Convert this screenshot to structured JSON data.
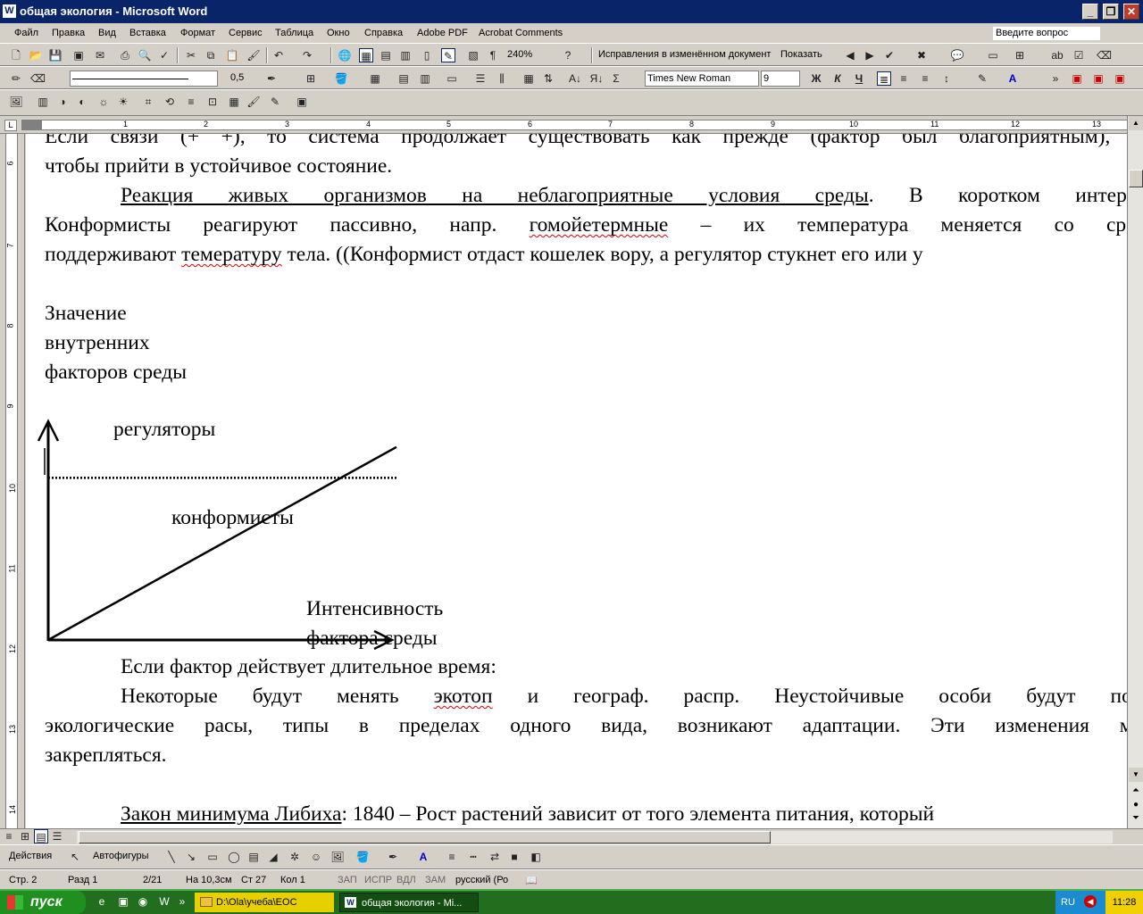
{
  "window": {
    "title": "общая экология - Microsoft Word",
    "app_icon": "W",
    "ask_placeholder": "Введите вопрос"
  },
  "menu": [
    "Файл",
    "Правка",
    "Вид",
    "Вставка",
    "Формат",
    "Сервис",
    "Таблица",
    "Окно",
    "Справка",
    "Adobe PDF",
    "Acrobat Comments"
  ],
  "toolbar": {
    "zoom": "240%",
    "track_changes_view": "Исправления в изменённом документ",
    "show_label": "Показать",
    "line_weight": "0,5",
    "font_name": "Times New Roman",
    "font_size": "9"
  },
  "ruler": {
    "h_numbers": [
      "1",
      "2",
      "3",
      "4",
      "5",
      "6",
      "7",
      "8",
      "9",
      "10",
      "11",
      "12",
      "13"
    ],
    "v_numbers": [
      "6",
      "7",
      "8",
      "9",
      "10",
      "11",
      "12",
      "13",
      "14"
    ]
  },
  "document": {
    "line0": "Если связи (+ +), то система продолжает существовать как прежде (фактор был благоприятным), со",
    "line1": "чтобы прийти в устойчивое состояние.",
    "p2_title": "Реакция живых организмов на неблагоприятные условия среды",
    "p2_rest": ". В коротком интервал",
    "p3_a": "Конформисты реагируют пассивно, напр.",
    "p3_sq": "гомойетермные",
    "p3_b": "– их температура меняется со средо",
    "p4_a": "поддерживают",
    "p4_sq": "темературу",
    "p4_b": "тела. ((Конформист отдаст кошелек вору, а регулятор стукнет его или у",
    "ylabel_1": "Значение",
    "ylabel_2": "внутренних",
    "ylabel_3": "факторов среды",
    "p5": "Если фактор действует длительное время:",
    "p6_a": "Некоторые будут менять",
    "p6_sq": "экотоп",
    "p6_b": "и географ. распр. Неустойчивые особи будут поги",
    "p7": "экологические расы, типы в пределах одного вида, возникают адаптации. Эти изменения мог",
    "p8": "закрепляться.",
    "p9_title": "Закон минимума Либиха",
    "p9_rest": ": 1840 – Рост растений зависит от того элемента питания, который"
  },
  "chart_data": {
    "type": "line",
    "title": "",
    "ylabel": "Значение внутренних факторов среды",
    "xlabel": "Интенсивность фактора среды",
    "series": [
      {
        "name": "регуляторы",
        "style": "dotted",
        "x": [
          0,
          1
        ],
        "y": [
          0.84,
          0.84
        ]
      },
      {
        "name": "конформисты",
        "style": "solid",
        "x": [
          0,
          1
        ],
        "y": [
          0,
          1
        ]
      }
    ],
    "xlim": [
      0,
      1
    ],
    "ylim": [
      0,
      1.05
    ],
    "grid": false,
    "line_color": "#000000"
  },
  "drawing_toolbar": {
    "actions": "Действия",
    "autoshapes": "Автофигуры"
  },
  "status": {
    "page": "Стр. 2",
    "section": "Разд 1",
    "pages": "2/21",
    "at": "На 10,3см",
    "line": "Ст 27",
    "col": "Кол 1",
    "rec": "ЗАП",
    "trk": "ИСПР",
    "ext": "ВДЛ",
    "ovr": "ЗАМ",
    "lang": "русский (Ро"
  },
  "taskbar": {
    "start": "пуск",
    "task1": "D:\\Ola\\учеба\\ЕОС",
    "task2": "общая экология - Mi...",
    "lang": "RU",
    "clock": "11:28"
  },
  "colors": {
    "titlebar": "#0a246a",
    "taskbar": "#226e1e",
    "spell_error": "#e00000"
  }
}
